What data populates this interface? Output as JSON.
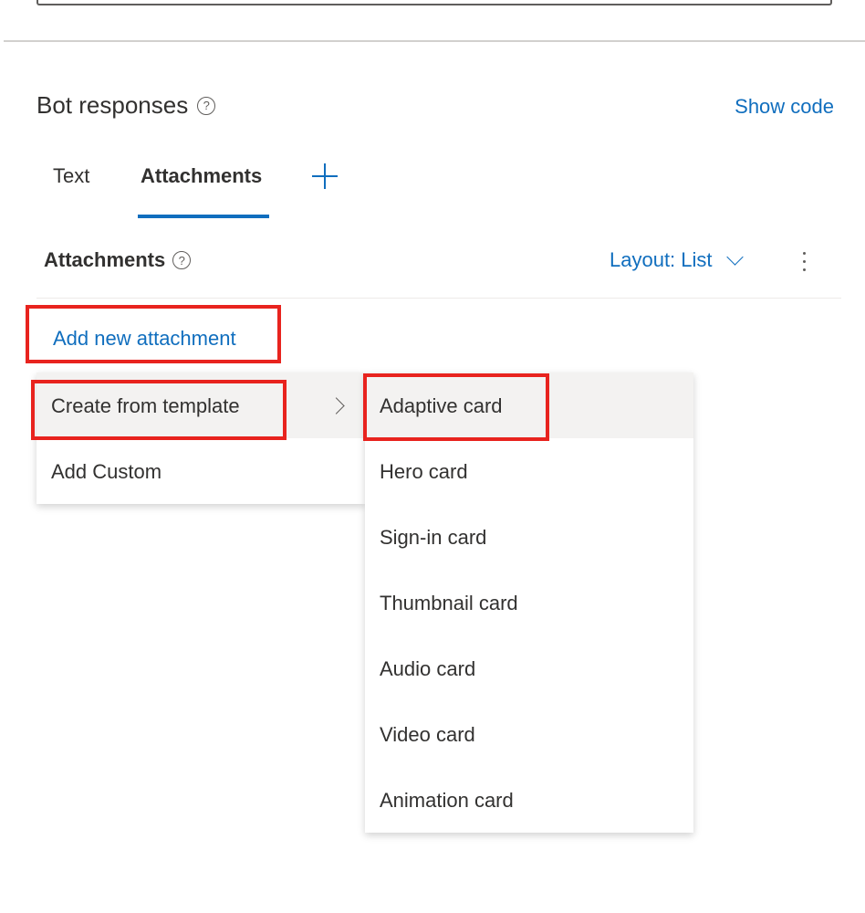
{
  "section": {
    "title": "Bot responses",
    "show_code": "Show code"
  },
  "tabs": [
    {
      "label": "Text"
    },
    {
      "label": "Attachments"
    }
  ],
  "attachments": {
    "header": "Attachments",
    "layout_label": "Layout: List",
    "add_new": "Add new attachment"
  },
  "menu": {
    "items": [
      {
        "label": "Create from template"
      },
      {
        "label": "Add Custom"
      }
    ]
  },
  "submenu": {
    "items": [
      {
        "label": "Adaptive card"
      },
      {
        "label": "Hero card"
      },
      {
        "label": "Sign-in card"
      },
      {
        "label": "Thumbnail card"
      },
      {
        "label": "Audio card"
      },
      {
        "label": "Video card"
      },
      {
        "label": "Animation card"
      }
    ]
  },
  "colors": {
    "accent": "#106ebe",
    "highlight": "#e8231e",
    "text": "#323130"
  },
  "icons": [
    "help-icon",
    "plus-icon",
    "chevron-down-icon",
    "more-vertical-icon",
    "chevron-right-icon"
  ]
}
